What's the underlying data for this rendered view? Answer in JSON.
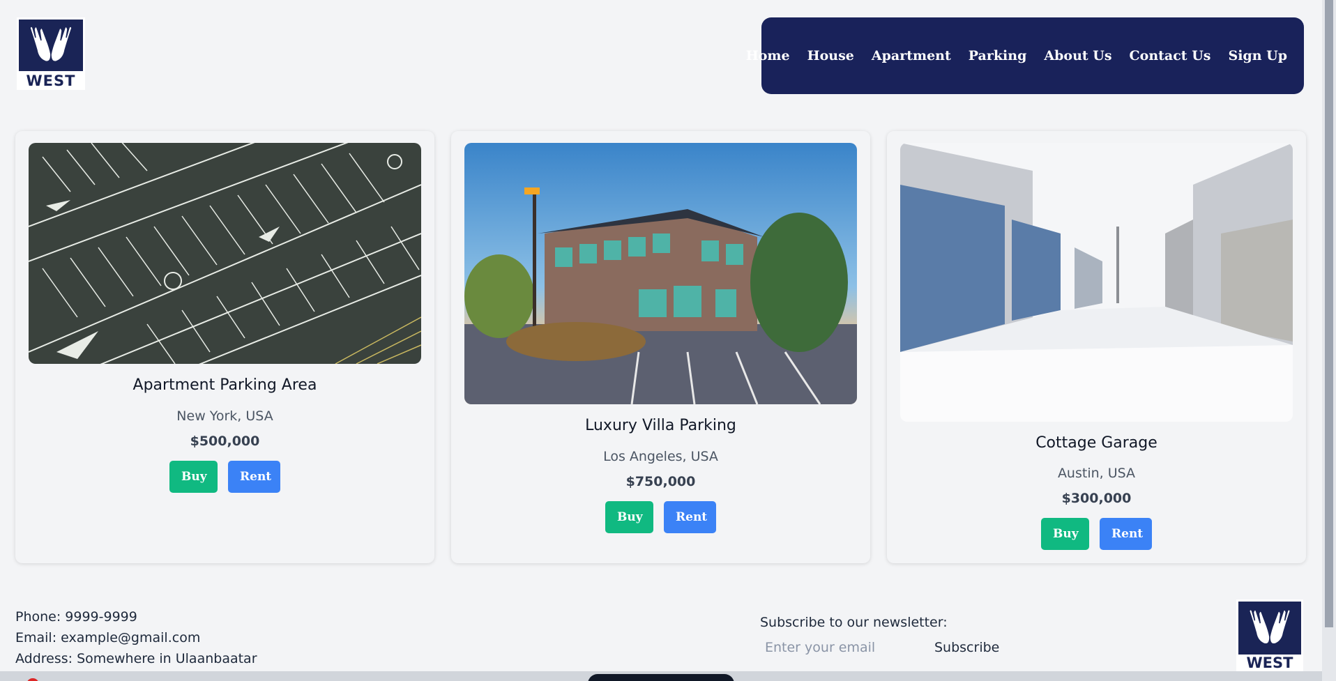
{
  "brand": {
    "logo_text": "WEST",
    "primary_color": "#19225a"
  },
  "nav": {
    "items": [
      {
        "label": "Home"
      },
      {
        "label": "House"
      },
      {
        "label": "Apartment"
      },
      {
        "label": "Parking"
      },
      {
        "label": "About Us"
      },
      {
        "label": "Contact Us"
      },
      {
        "label": "Sign Up"
      }
    ]
  },
  "listings": [
    {
      "title": "Apartment Parking Area",
      "location": "New York, USA",
      "price": "$500,000",
      "buy_label": "Buy",
      "rent_label": "Rent",
      "image": "aerial-parking-lot"
    },
    {
      "title": "Luxury Villa Parking",
      "location": "Los Angeles, USA",
      "price": "$750,000",
      "buy_label": "Buy",
      "rent_label": "Rent",
      "image": "villa-building-parking"
    },
    {
      "title": "Cottage Garage",
      "location": "Austin, USA",
      "price": "$300,000",
      "buy_label": "Buy",
      "rent_label": "Rent",
      "image": "snowy-garage-alley"
    }
  ],
  "footer": {
    "phone": "Phone: 9999-9999",
    "email": "Email: example@gmail.com",
    "address": "Address: Somewhere in Ulaanbaatar",
    "newsletter_label": "Subscribe to our newsletter:",
    "email_placeholder": "Enter your email",
    "subscribe_label": "Subscribe"
  },
  "colors": {
    "buy": "#10b981",
    "rent": "#3b82f6"
  }
}
